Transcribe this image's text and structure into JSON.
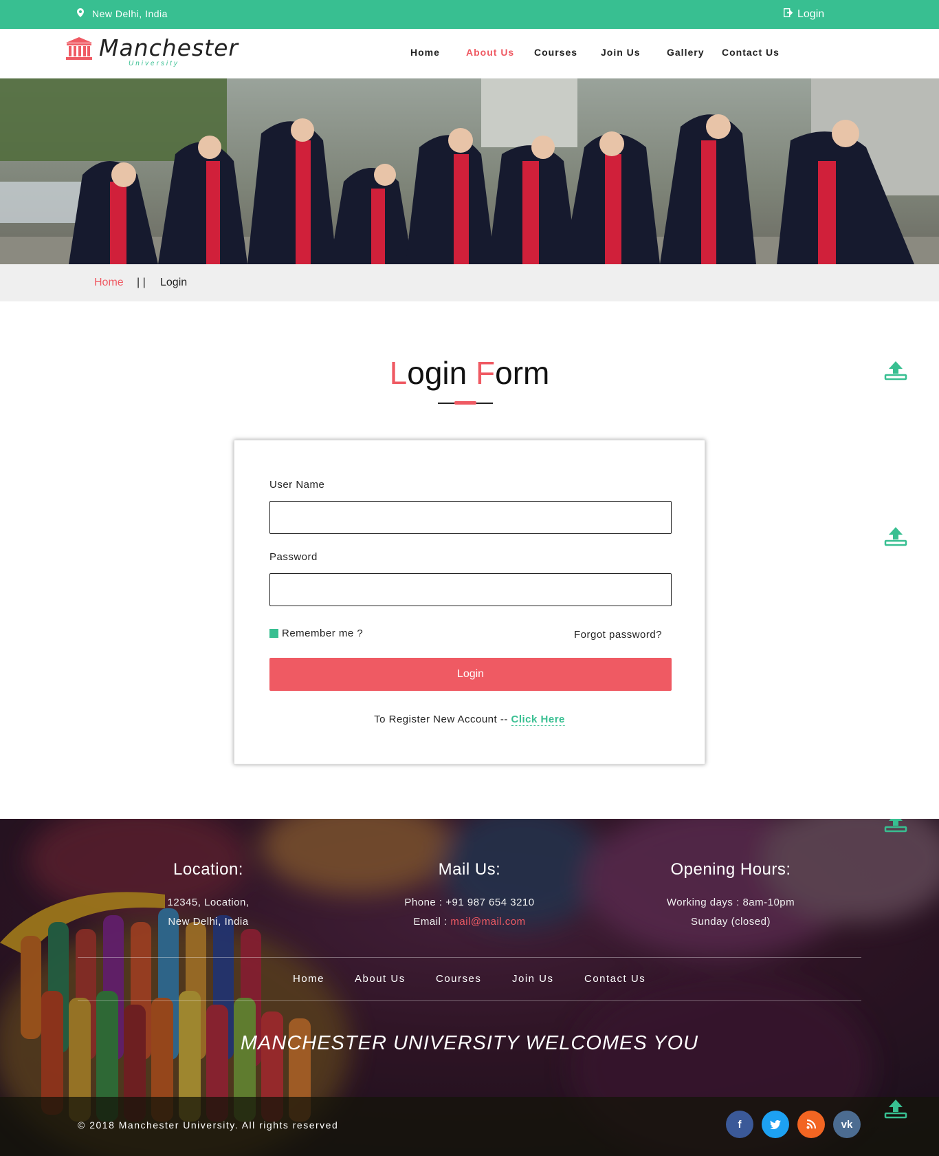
{
  "topbar": {
    "location": "New Delhi, India",
    "login": "Login"
  },
  "logo": {
    "name": "Manchester",
    "sub": "University"
  },
  "nav": [
    {
      "label": "Home",
      "active": false
    },
    {
      "label": "About Us",
      "active": true
    },
    {
      "label": "Courses",
      "active": false
    },
    {
      "label": "Join Us",
      "active": false
    },
    {
      "label": "Gallery",
      "active": false
    },
    {
      "label": "Contact Us",
      "active": false
    }
  ],
  "breadcrumb": {
    "home": "Home",
    "sep": "| |",
    "current": "Login"
  },
  "title": {
    "l1": "L",
    "rest1": "ogin ",
    "l2": "F",
    "rest2": "orm"
  },
  "form": {
    "username_label": "User Name",
    "username_value": "",
    "password_label": "Password",
    "password_value": "",
    "remember": "Remember me ?",
    "forgot": "Forgot password?",
    "login_button": "Login",
    "register_text": "To Register New Account -- ",
    "register_link": "Click Here"
  },
  "footer": {
    "location": {
      "title": "Location:",
      "line1": "12345, Location,",
      "line2": "New Delhi, India"
    },
    "mail": {
      "title": "Mail Us:",
      "phone": "Phone : +91 987 654 3210",
      "email_label": "Email : ",
      "email": "mail@mail.com"
    },
    "hours": {
      "title": "Opening Hours:",
      "line1": "Working days : 8am-10pm",
      "line2": "Sunday (closed)"
    },
    "nav": [
      "Home",
      "About Us",
      "Courses",
      "Join Us",
      "Contact Us"
    ],
    "welcome": "MANCHESTER UNIVERSITY WELCOMES YOU",
    "copyright": "© 2018 Manchester University. All rights reserved",
    "social": [
      {
        "name": "facebook",
        "glyph": "f",
        "color": "#3b5998"
      },
      {
        "name": "twitter",
        "glyph": "t",
        "color": "#1da1f2"
      },
      {
        "name": "rss",
        "glyph": "◉",
        "color": "#f26522"
      },
      {
        "name": "vk",
        "glyph": "vk",
        "color": "#4c6c91"
      }
    ]
  },
  "colors": {
    "accent_green": "#38bf91",
    "accent_red": "#ef5a63"
  }
}
